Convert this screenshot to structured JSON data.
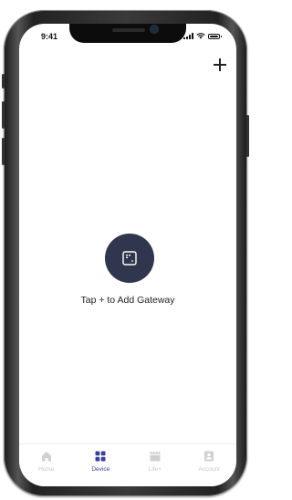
{
  "status_bar": {
    "time": "9:41",
    "icons": [
      "signal-icon",
      "wifi-icon",
      "battery-icon"
    ]
  },
  "header": {
    "add_icon": "plus-icon"
  },
  "empty_state": {
    "icon": "gateway-icon",
    "message": "Tap + to Add Gateway"
  },
  "tabs": [
    {
      "label": "Home",
      "icon": "home-icon",
      "active": false
    },
    {
      "label": "Device",
      "icon": "device-grid-icon",
      "active": true
    },
    {
      "label": "Life+",
      "icon": "life-icon",
      "active": false
    },
    {
      "label": "Account",
      "icon": "account-icon",
      "active": false
    }
  ],
  "colors": {
    "accent": "#3b3f9c",
    "gateway_circle": "#2f364d",
    "inactive_tab": "#c8c8c8"
  }
}
